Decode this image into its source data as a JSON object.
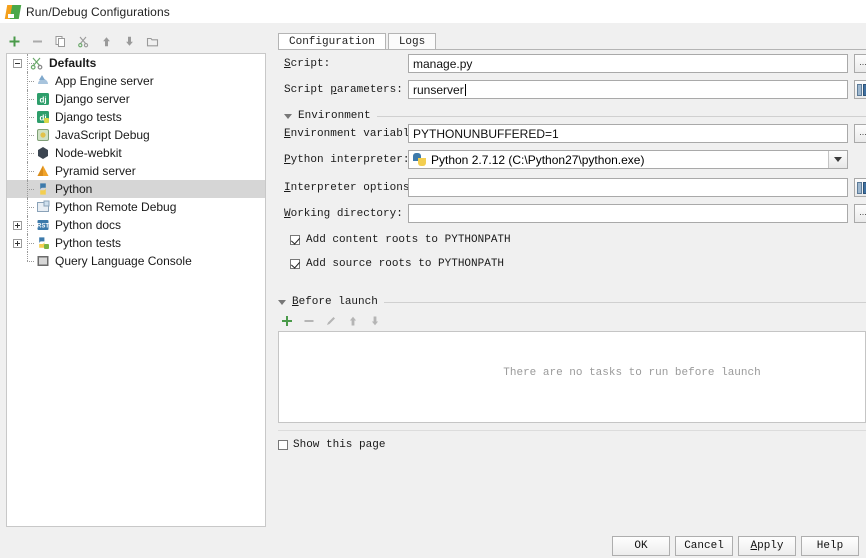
{
  "window": {
    "title": "Run/Debug Configurations",
    "icon": "pycharm-icon"
  },
  "left_toolbar": {
    "items": [
      {
        "name": "add-button",
        "icon": "plus-icon",
        "tooltip": "Add New Configuration"
      },
      {
        "name": "remove-button",
        "icon": "minus-icon",
        "tooltip": "Remove Configuration"
      },
      {
        "name": "copy-button",
        "icon": "copy-icon",
        "tooltip": "Copy Configuration"
      },
      {
        "name": "edit-templates-button",
        "icon": "scissors-icon",
        "tooltip": "Edit Templates"
      },
      {
        "name": "move-up-button",
        "icon": "arrow-up-icon",
        "tooltip": "Move Up"
      },
      {
        "name": "move-down-button",
        "icon": "arrow-down-icon",
        "tooltip": "Move Down"
      },
      {
        "name": "new-folder-button",
        "icon": "folder-icon",
        "tooltip": "Create New Folder"
      }
    ]
  },
  "tree": {
    "root": {
      "label": "Defaults",
      "icon": "templates-icon",
      "expanded": true
    },
    "items": [
      {
        "label": "App Engine server",
        "icon": "app-engine-icon",
        "expandable": false,
        "selected": false
      },
      {
        "label": "Django server",
        "icon": "django-icon",
        "expandable": false,
        "selected": false
      },
      {
        "label": "Django tests",
        "icon": "django-tests-icon",
        "expandable": false,
        "selected": false
      },
      {
        "label": "JavaScript Debug",
        "icon": "javascript-debug-icon",
        "expandable": false,
        "selected": false
      },
      {
        "label": "Node-webkit",
        "icon": "node-webkit-icon",
        "expandable": false,
        "selected": false
      },
      {
        "label": "Pyramid server",
        "icon": "pyramid-icon",
        "expandable": false,
        "selected": false
      },
      {
        "label": "Python",
        "icon": "python-icon",
        "expandable": false,
        "selected": true
      },
      {
        "label": "Python Remote Debug",
        "icon": "remote-debug-icon",
        "expandable": false,
        "selected": false
      },
      {
        "label": "Python docs",
        "icon": "python-docs-icon",
        "expandable": true,
        "selected": false
      },
      {
        "label": "Python tests",
        "icon": "python-tests-icon",
        "expandable": true,
        "selected": false
      },
      {
        "label": "Query Language Console",
        "icon": "query-console-icon",
        "expandable": false,
        "selected": false
      }
    ]
  },
  "tabs": [
    {
      "label": "Configuration",
      "active": true
    },
    {
      "label": "Logs",
      "active": false
    }
  ],
  "form": {
    "script": {
      "label_pre": "S",
      "label_mnemonic": "c",
      "label_post": "ript:",
      "label": "Script:",
      "value": "manage.py",
      "browse": "..."
    },
    "script_parameters": {
      "label_pre": "Script ",
      "label_mnemonic": "p",
      "label_post": "arameters:",
      "label": "Script parameters:",
      "value": "runserver",
      "browse": "macro-icon"
    },
    "environment_section": {
      "label": "Environment",
      "expanded": true
    },
    "environment_variables": {
      "label_pre": "",
      "label_mnemonic": "E",
      "label_post": "nvironment variables:",
      "label": "Environment variables:",
      "value": "PYTHONUNBUFFERED=1",
      "browse": "..."
    },
    "python_interpreter": {
      "label_pre": "",
      "label_mnemonic": "P",
      "label_post": "ython interpreter:",
      "label": "Python interpreter:",
      "value": "Python 2.7.12 (C:\\Python27\\python.exe)"
    },
    "interpreter_options": {
      "label_pre": "",
      "label_mnemonic": "I",
      "label_post": "nterpreter options:",
      "label": "Interpreter options:",
      "value": "",
      "browse": "macro-icon"
    },
    "working_directory": {
      "label_pre": "",
      "label_mnemonic": "W",
      "label_post": "orking directory:",
      "label": "Working directory:",
      "value": "",
      "browse": "..."
    },
    "add_content_roots": {
      "label": "Add content roots to PYTHONPATH",
      "checked": true
    },
    "add_source_roots": {
      "label": "Add source roots to PYTHONPATH",
      "checked": true
    }
  },
  "before_launch": {
    "section_label_pre": "",
    "section_mnemonic": "B",
    "section_label_post": "efore launch",
    "section_label": "Before launch",
    "toolbar": [
      {
        "name": "add-task-button",
        "icon": "plus-icon"
      },
      {
        "name": "remove-task-button",
        "icon": "minus-icon"
      },
      {
        "name": "edit-task-button",
        "icon": "pencil-icon"
      },
      {
        "name": "move-task-up-button",
        "icon": "arrow-up-icon"
      },
      {
        "name": "move-task-down-button",
        "icon": "arrow-down-icon"
      }
    ],
    "empty_message": "There are no tasks to run before launch"
  },
  "show_this_page": {
    "label": "Show this page",
    "checked": false
  },
  "buttons": [
    {
      "label": "OK",
      "mnemonic": "",
      "name": "ok-button"
    },
    {
      "label": "Cancel",
      "mnemonic": "",
      "name": "cancel-button"
    },
    {
      "label": "Apply",
      "mnemonic": "A",
      "name": "apply-button"
    },
    {
      "label": "Help",
      "mnemonic": "",
      "name": "help-button"
    }
  ],
  "colors": {
    "accent_green": "#4a9a4a",
    "selection": "#d6d6d6",
    "window_bg": "#f0f0f0",
    "field_bg": "#ffffff"
  }
}
